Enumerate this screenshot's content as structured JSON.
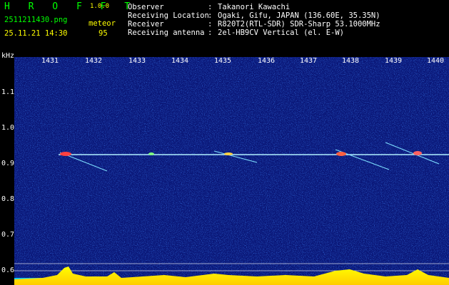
{
  "header": {
    "brand": "H R O F F T",
    "version": "1.0.0",
    "filename": "2511211430.png",
    "datetime": "25.11.21 14:30",
    "type_label": "meteor",
    "count": "95",
    "info": [
      {
        "label": "Observer",
        "value": "Takanori Kawachi"
      },
      {
        "label": "Receiving Location",
        "value": "Ogaki, Gifu, JAPAN (136.60E, 35.35N)"
      },
      {
        "label": "Receiver",
        "value": "R820T2(RTL-SDR) SDR-Sharp 53.1000MHz"
      },
      {
        "label": "Receiving antenna",
        "value": "2el-HB9CV Vertical (el. E-W)"
      }
    ]
  },
  "plot": {
    "y_unit": "kHz",
    "y_ticks": [
      "1.1",
      "1.0",
      "0.9",
      "0.8",
      "0.7",
      "0.6"
    ],
    "x_ticks": [
      "1431",
      "1432",
      "1433",
      "1434",
      "1435",
      "1436",
      "1437",
      "1438",
      "1439",
      "1440"
    ]
  },
  "colors": {
    "background": "#000000",
    "spectrogram": "#0a1a8c",
    "brand": "#00ff00",
    "accent": "#ffff00",
    "text": "#ffffff"
  }
}
